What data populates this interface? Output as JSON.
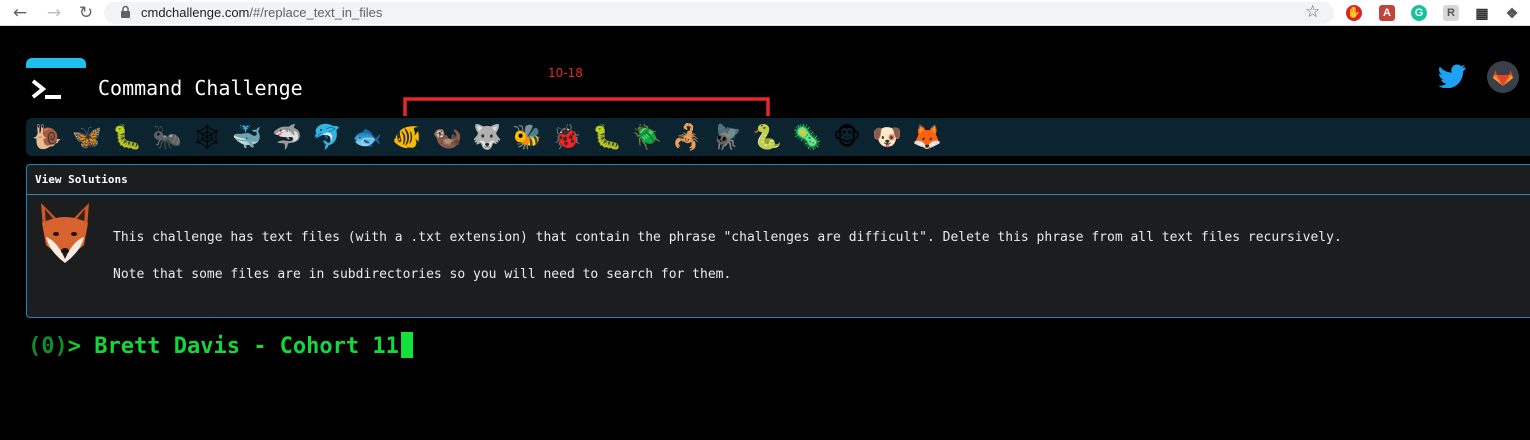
{
  "browser": {
    "url_host": "cmdchallenge.com",
    "url_path": "/#/replace_text_in_files",
    "back_icon": "back-arrow-icon",
    "forward_icon": "forward-arrow-icon",
    "reload_icon": "reload-icon",
    "bookmark_icon": "star-icon",
    "extensions": [
      "adblock-icon",
      "pdf-icon",
      "grammarly-icon",
      "reader-icon",
      "grid-icon",
      "puzzle-icon"
    ]
  },
  "header": {
    "title": "Command Challenge",
    "twitter_icon": "twitter-icon",
    "gitlab_icon": "gitlab-icon"
  },
  "annotation": {
    "label": "10-18",
    "color": "#e8262b"
  },
  "challenges": {
    "icons": [
      {
        "emoji": "🐌",
        "name": "snail-icon"
      },
      {
        "emoji": "🦋",
        "name": "butterfly-icon"
      },
      {
        "emoji": "🐛",
        "name": "caterpillar-icon"
      },
      {
        "emoji": "🐜",
        "name": "ant-icon"
      },
      {
        "emoji": "🕸",
        "name": "spider-web-icon"
      },
      {
        "emoji": "🐳",
        "name": "whale-icon"
      },
      {
        "emoji": "🦈",
        "name": "shark-icon"
      },
      {
        "emoji": "🐬",
        "name": "dolphin-icon"
      },
      {
        "emoji": "🐟",
        "name": "fish-icon"
      },
      {
        "emoji": "🐠",
        "name": "tropical-fish-icon"
      },
      {
        "emoji": "🦦",
        "name": "otter-icon"
      },
      {
        "emoji": "🐺",
        "name": "wolf-icon"
      },
      {
        "emoji": "🐝",
        "name": "bee-icon"
      },
      {
        "emoji": "🐞",
        "name": "ladybug-icon"
      },
      {
        "emoji": "🐛",
        "name": "worm-icon"
      },
      {
        "emoji": "🪲",
        "name": "beetle-icon"
      },
      {
        "emoji": "🦂",
        "name": "scorpion-icon"
      },
      {
        "emoji": "🪰",
        "name": "fly-icon"
      },
      {
        "emoji": "🐍",
        "name": "snake-icon"
      },
      {
        "emoji": "🦠",
        "name": "microbe-icon"
      },
      {
        "emoji": "🐵",
        "name": "monkey-icon"
      },
      {
        "emoji": "🐶",
        "name": "dog-icon"
      },
      {
        "emoji": "🦊",
        "name": "fox-icon"
      }
    ]
  },
  "panel": {
    "heading": "View Solutions",
    "avatar_icon": "fox-icon",
    "line1": "This challenge has text files (with a .txt extension) that contain the phrase \"challenges are difficult\". Delete this phrase from all text files recursively.",
    "line2": "Note that some files are in subdirectories so you will need to search for them."
  },
  "terminal": {
    "count": "(0)",
    "arrow": ">",
    "input": "Brett Davis - Cohort 11"
  },
  "colors": {
    "background": "#000000",
    "strip": "#0b2430",
    "panel_border": "#1f86b8",
    "prompt_green": "#17d63a",
    "accent_blue": "#1ec0f0"
  }
}
